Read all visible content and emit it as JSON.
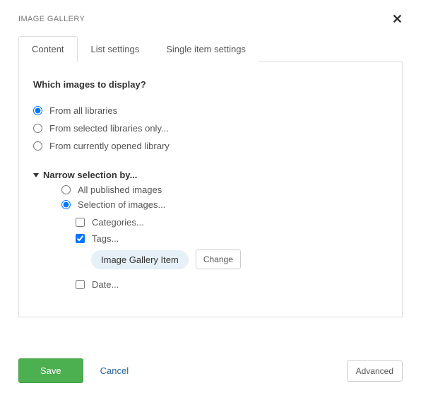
{
  "header": {
    "title": "IMAGE GALLERY"
  },
  "tabs": {
    "content": "Content",
    "list": "List settings",
    "single": "Single item settings"
  },
  "panel": {
    "question": "Which images to display?",
    "sources": {
      "all": "From all libraries",
      "selected": "From selected libraries only...",
      "current": "From currently opened library"
    },
    "narrow": {
      "header": "Narrow selection by...",
      "allPublished": "All published images",
      "selection": "Selection of images...",
      "categories": "Categories...",
      "tags": "Tags...",
      "chip": "Image Gallery Item",
      "change": "Change",
      "date": "Date..."
    }
  },
  "footer": {
    "save": "Save",
    "cancel": "Cancel",
    "advanced": "Advanced"
  }
}
